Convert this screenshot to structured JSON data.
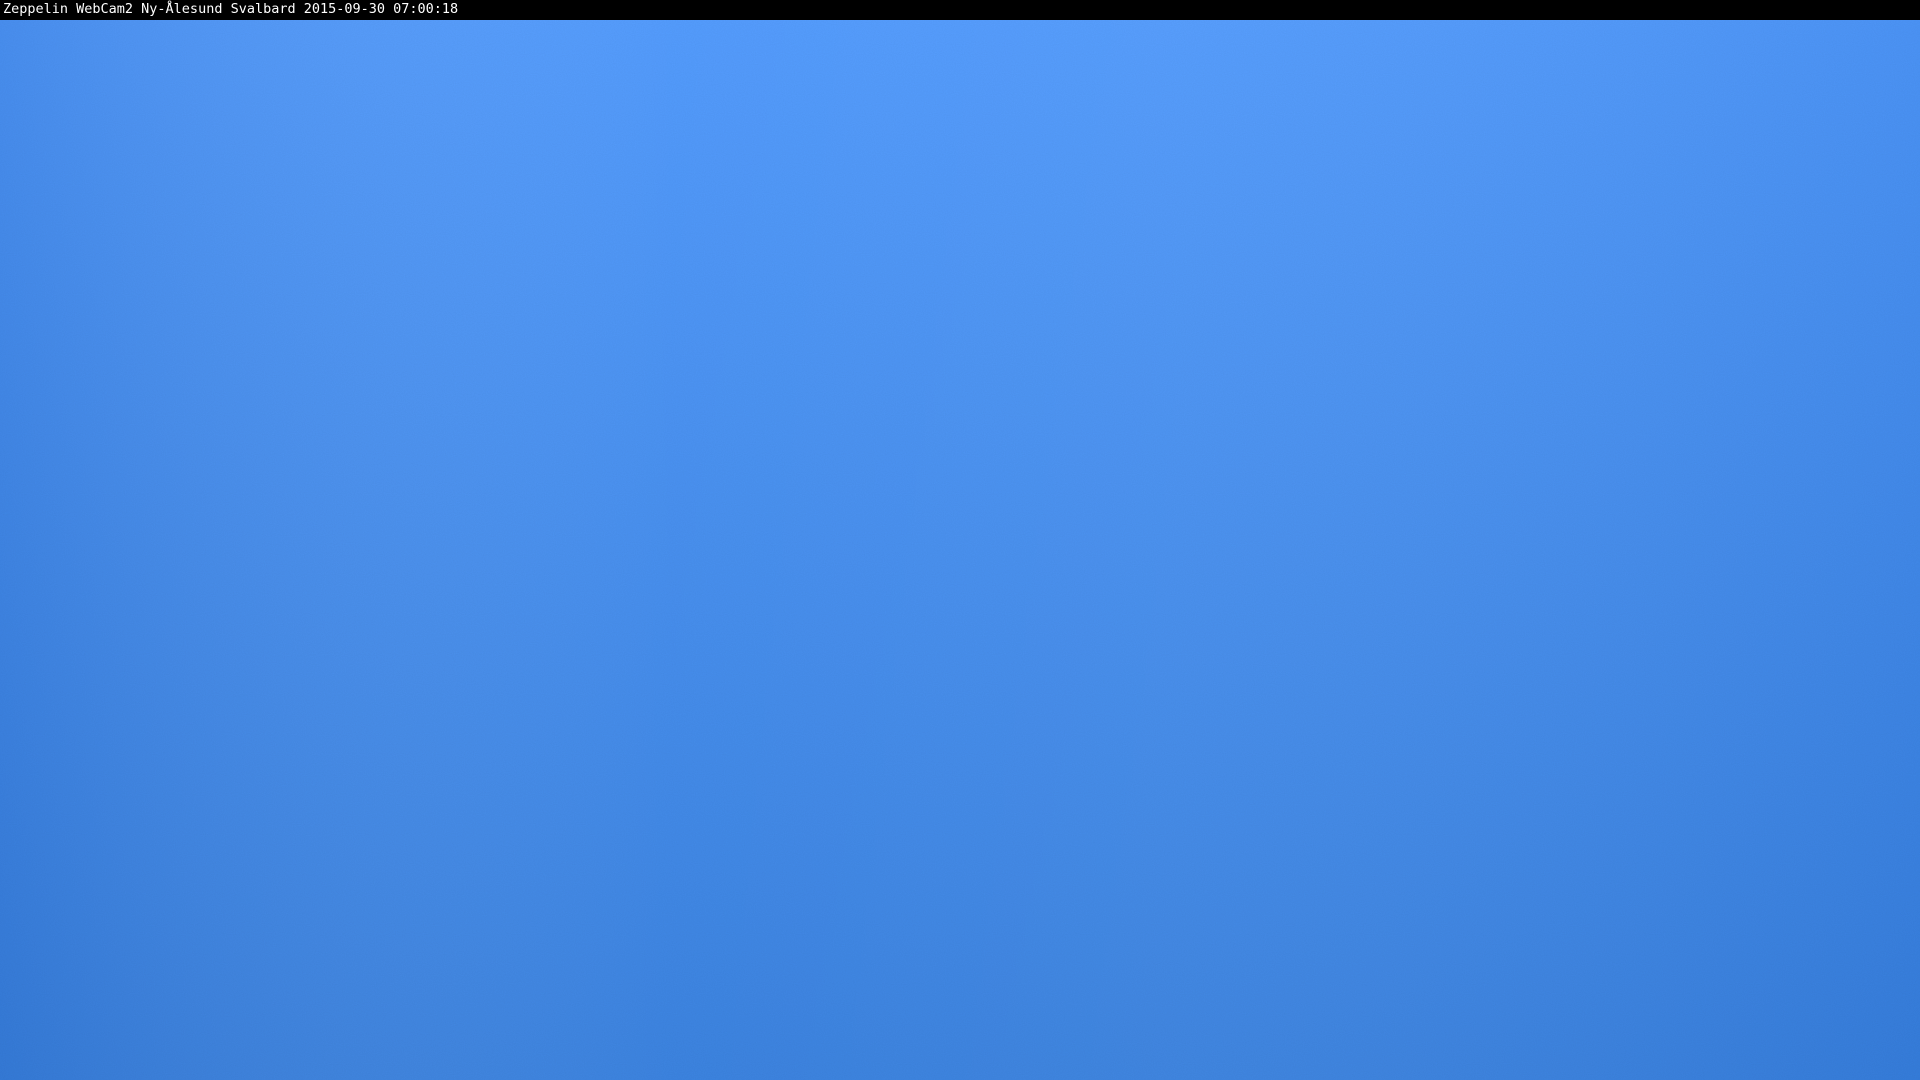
{
  "webcam": {
    "caption": "Zeppelin WebCam2 Ny-Ålesund Svalbard 2015-09-30 07:00:18"
  },
  "colors": {
    "caption_bar": "#000000",
    "caption_text": "#ffffff",
    "sky_top_left": "#478fef",
    "sky_top_center": "#4f9aff",
    "sky_top_right": "#4d97fc",
    "sky_bottom_left": "#3b82e4",
    "sky_bottom_right": "#3680e0"
  },
  "icons": []
}
